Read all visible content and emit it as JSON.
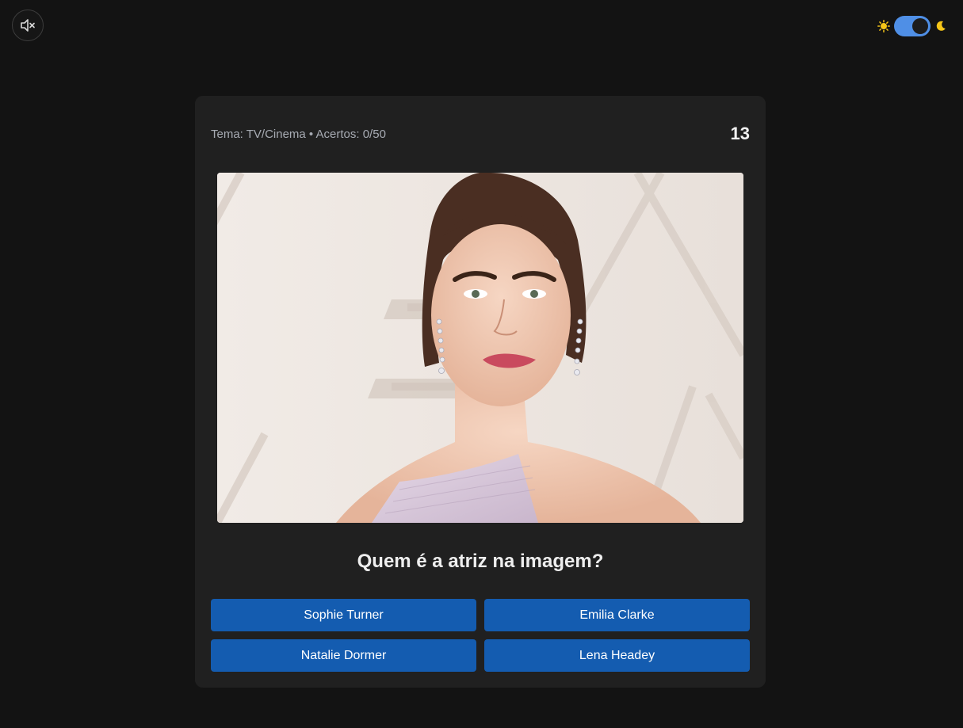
{
  "header": {
    "meta": "Tema: TV/Cinema • Acertos: 0/50",
    "timer": "13"
  },
  "controls": {
    "mute_icon": "speaker-muted-icon",
    "theme_mode": "dark",
    "sun_icon": "sun-icon",
    "moon_icon": "moon-icon"
  },
  "image": {
    "alt": "Foto de uma atriz"
  },
  "question": "Quem é a atriz na imagem?",
  "answers": [
    "Sophie Turner",
    "Emilia Clarke",
    "Natalie Dormer",
    "Lena Headey"
  ],
  "colors": {
    "background": "#131313",
    "card": "#202020",
    "button": "#145cb0",
    "toggle": "#4f8fe6",
    "sun": "#f5c518"
  }
}
